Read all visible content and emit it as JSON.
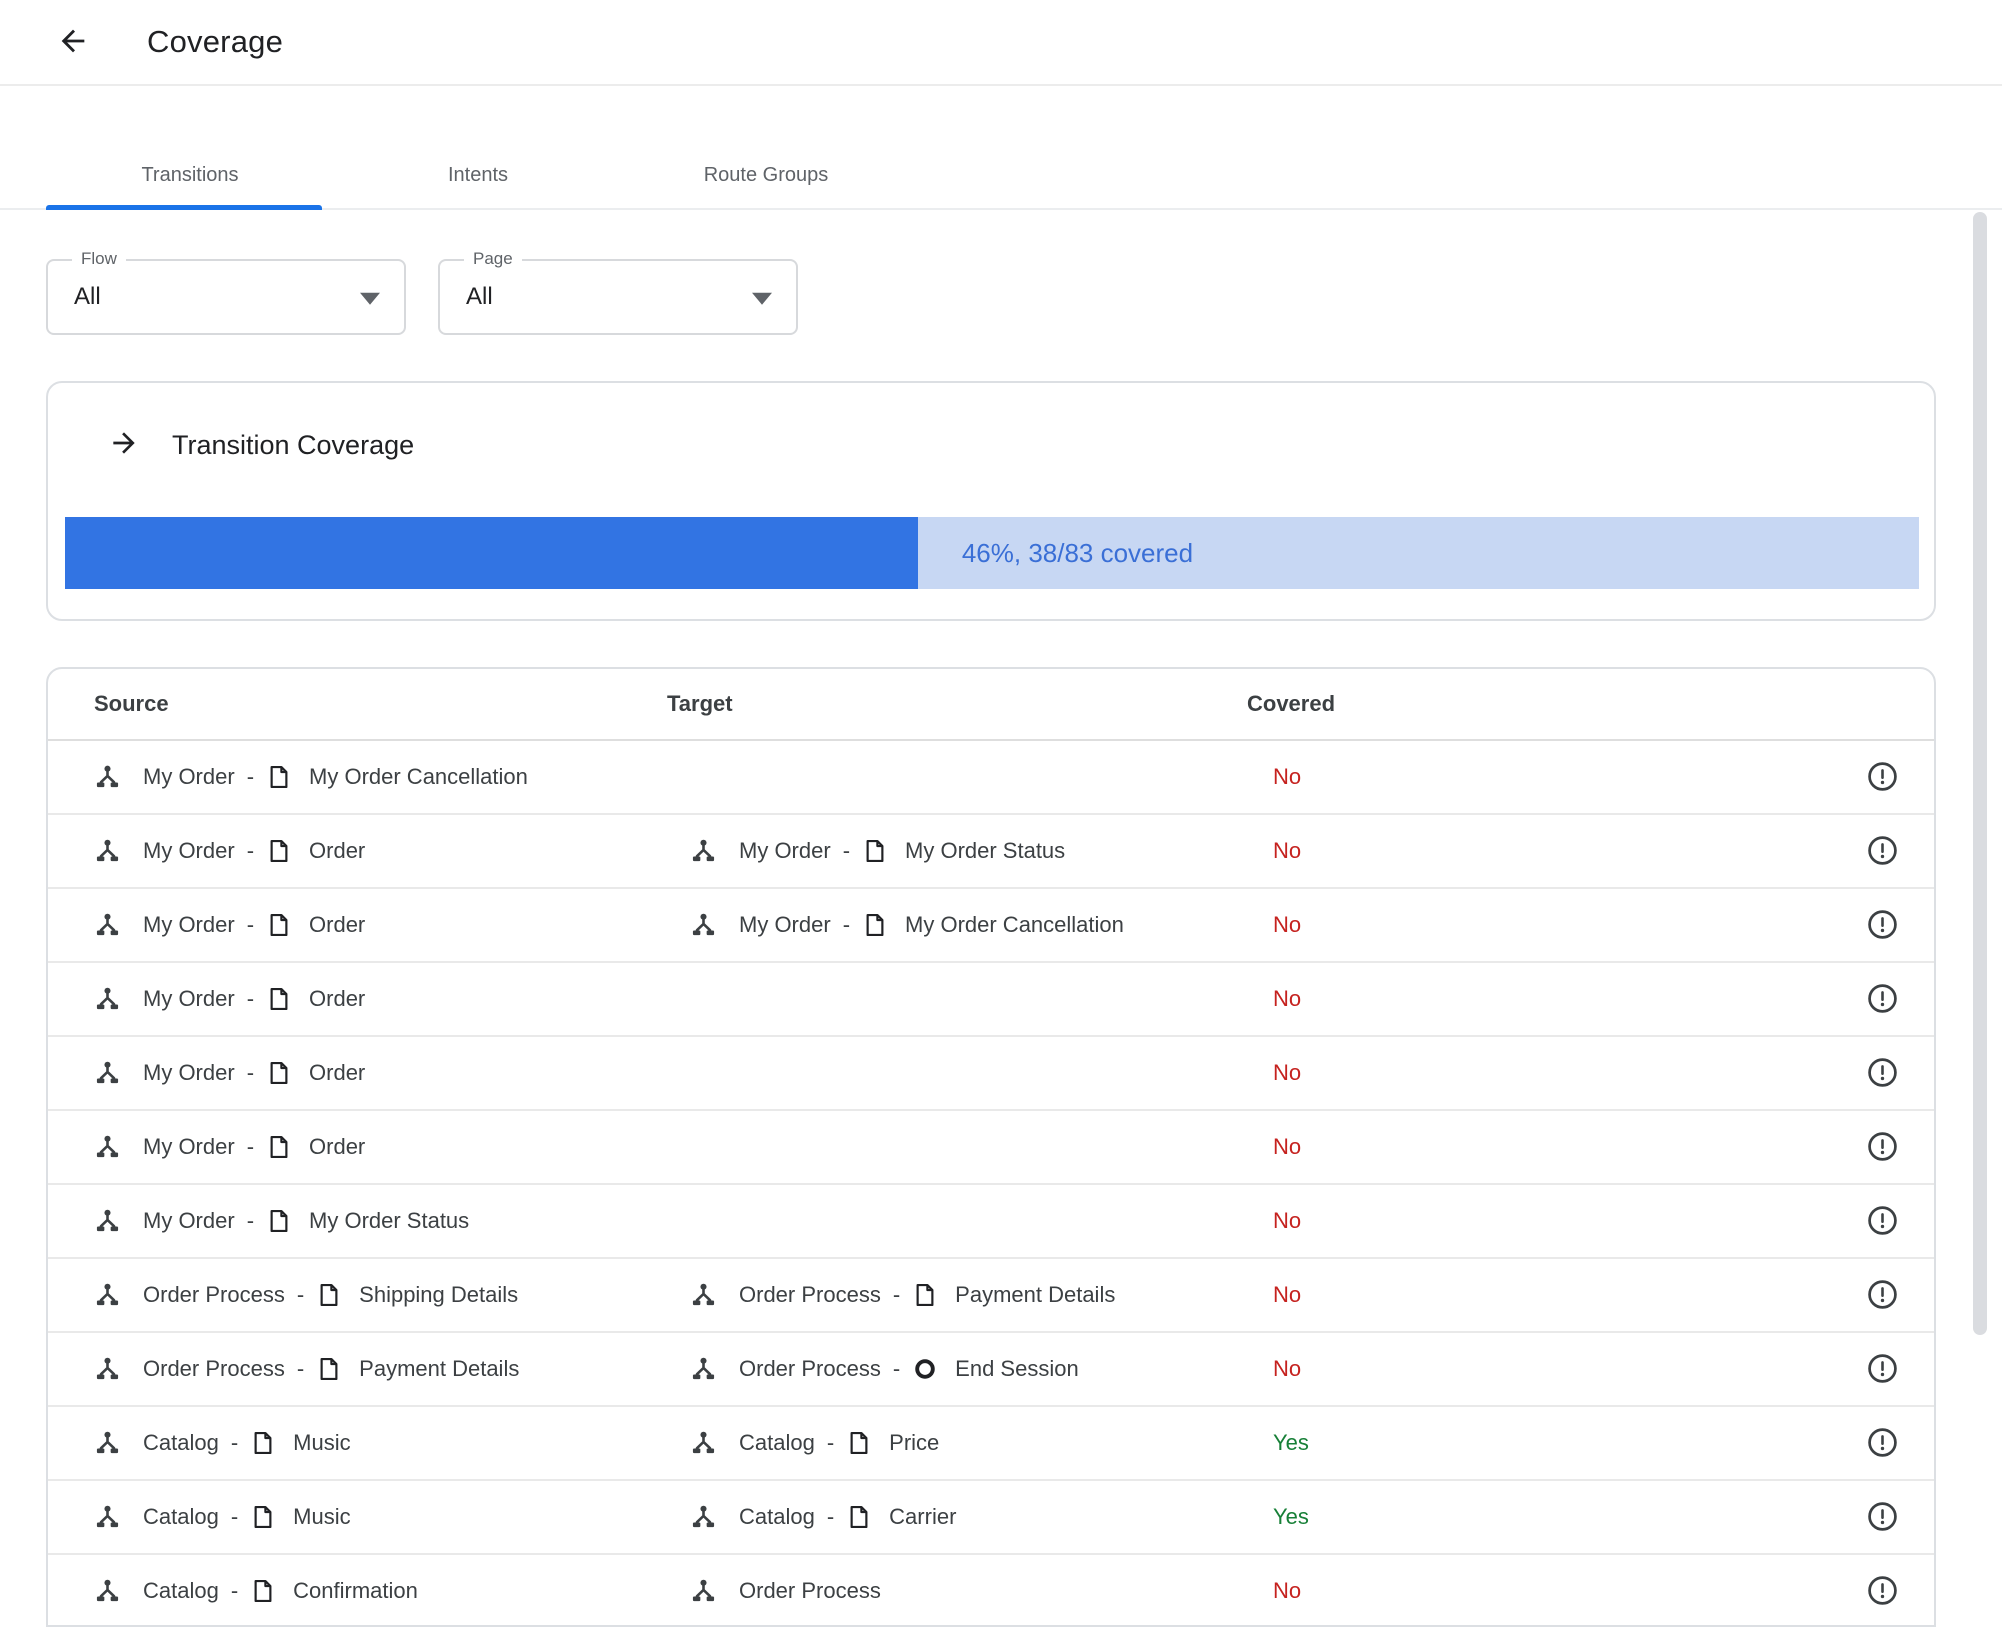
{
  "app_bar": {
    "title": "Coverage"
  },
  "tabs": [
    {
      "label": "Transitions",
      "active": true
    },
    {
      "label": "Intents",
      "active": false
    },
    {
      "label": "Route Groups",
      "active": false
    }
  ],
  "filters": {
    "flow": {
      "label": "Flow",
      "value": "All"
    },
    "page": {
      "label": "Page",
      "value": "All"
    }
  },
  "coverage": {
    "title": "Transition Coverage",
    "percent": 46,
    "label": "46%, 38/83 covered"
  },
  "table": {
    "headers": {
      "source": "Source",
      "target": "Target",
      "covered": "Covered"
    },
    "rows": [
      {
        "source": {
          "flow": "My Order",
          "page": "My Order Cancellation",
          "page_icon": "page"
        },
        "target": null,
        "covered": "No"
      },
      {
        "source": {
          "flow": "My Order",
          "page": "Order",
          "page_icon": "page"
        },
        "target": {
          "flow": "My Order",
          "page": "My Order Status",
          "page_icon": "page"
        },
        "covered": "No"
      },
      {
        "source": {
          "flow": "My Order",
          "page": "Order",
          "page_icon": "page"
        },
        "target": {
          "flow": "My Order",
          "page": "My Order Cancellation",
          "page_icon": "page"
        },
        "covered": "No"
      },
      {
        "source": {
          "flow": "My Order",
          "page": "Order",
          "page_icon": "page"
        },
        "target": null,
        "covered": "No"
      },
      {
        "source": {
          "flow": "My Order",
          "page": "Order",
          "page_icon": "page"
        },
        "target": null,
        "covered": "No"
      },
      {
        "source": {
          "flow": "My Order",
          "page": "Order",
          "page_icon": "page"
        },
        "target": null,
        "covered": "No"
      },
      {
        "source": {
          "flow": "My Order",
          "page": "My Order Status",
          "page_icon": "page"
        },
        "target": null,
        "covered": "No"
      },
      {
        "source": {
          "flow": "Order Process",
          "page": "Shipping Details",
          "page_icon": "page"
        },
        "target": {
          "flow": "Order Process",
          "page": "Payment Details",
          "page_icon": "page"
        },
        "covered": "No"
      },
      {
        "source": {
          "flow": "Order Process",
          "page": "Payment Details",
          "page_icon": "page"
        },
        "target": {
          "flow": "Order Process",
          "page": "End Session",
          "page_icon": "end-session"
        },
        "covered": "No"
      },
      {
        "source": {
          "flow": "Catalog",
          "page": "Music",
          "page_icon": "page"
        },
        "target": {
          "flow": "Catalog",
          "page": "Price",
          "page_icon": "page"
        },
        "covered": "Yes"
      },
      {
        "source": {
          "flow": "Catalog",
          "page": "Music",
          "page_icon": "page"
        },
        "target": {
          "flow": "Catalog",
          "page": "Carrier",
          "page_icon": "page"
        },
        "covered": "Yes"
      },
      {
        "source": {
          "flow": "Catalog",
          "page": "Confirmation",
          "page_icon": "page"
        },
        "target": {
          "flow": "Order Process",
          "page": null
        },
        "covered": "No"
      }
    ]
  },
  "colors": {
    "accent_blue": "#1a73e8",
    "progress_fill": "#3274e3",
    "progress_track": "#c7d7f3",
    "progress_text": "#3a6fd6",
    "covered_no": "#c5221f",
    "covered_yes": "#188038"
  }
}
